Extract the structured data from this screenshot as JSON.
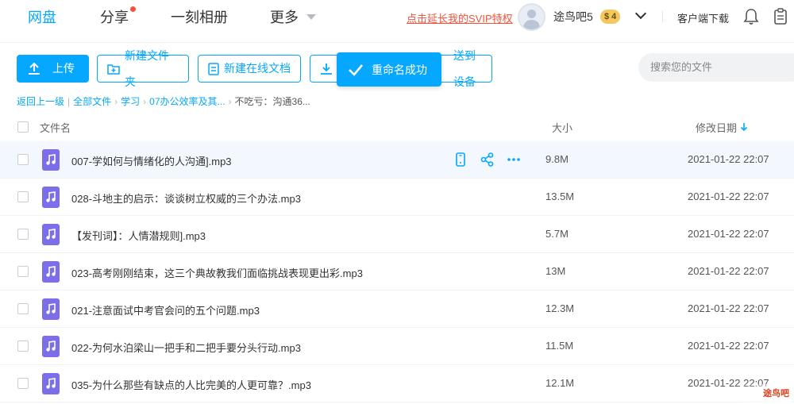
{
  "nav": {
    "tabs": [
      {
        "label": "网盘",
        "active": true
      },
      {
        "label": "分享",
        "dot": true
      },
      {
        "label": "一刻相册"
      },
      {
        "label": "更多"
      }
    ],
    "svip_link": "点击延长我的SVIP特权",
    "username": "途鸟吧5",
    "vip_badge": "$ 4",
    "client_download": "客户端下载"
  },
  "toolbar": {
    "upload": "上传",
    "new_folder": "新建文件夹",
    "new_doc": "新建在线文档",
    "send_device": "送到设备",
    "search_placeholder": "搜索您的文件"
  },
  "toast": "重命名成功",
  "breadcrumb": {
    "back": "返回上一级",
    "items": [
      "全部文件",
      "学习",
      "07办公效率及其...",
      "不吃亏：沟通36..."
    ]
  },
  "table": {
    "headers": {
      "name": "文件名",
      "size": "大小",
      "date": "修改日期"
    },
    "rows": [
      {
        "name": "007-学如何与情绪化的人沟通].mp3",
        "size": "9.8M",
        "date": "2021-01-22 22:07"
      },
      {
        "name": "028-斗地主的启示：谈谈树立权威的三个办法.mp3",
        "size": "13.5M",
        "date": "2021-01-22 22:07"
      },
      {
        "name": "【发刊词】：人情潜规则].mp3",
        "size": "5.7M",
        "date": "2021-01-22 22:07"
      },
      {
        "name": "023-高考刚刚结束，这三个典故教我们面临挑战表现更出彩.mp3",
        "size": "13M",
        "date": "2021-01-22 22:07"
      },
      {
        "name": "021-注意面试中考官会问的五个问题.mp3",
        "size": "12.3M",
        "date": "2021-01-22 22:07"
      },
      {
        "name": "022-为何水泊梁山一把手和二把手要分头行动.mp3",
        "size": "11.5M",
        "date": "2021-01-22 22:07"
      },
      {
        "name": "035-为什么那些有缺点的人比完美的人更可靠？.mp3",
        "size": "12.1M",
        "date": "2021-01-22 22:07"
      }
    ]
  },
  "watermark": "途鸟吧",
  "colors": {
    "accent": "#06a7ff",
    "audio_icon": "#7c6de8",
    "svip_link": "#f5533d"
  }
}
